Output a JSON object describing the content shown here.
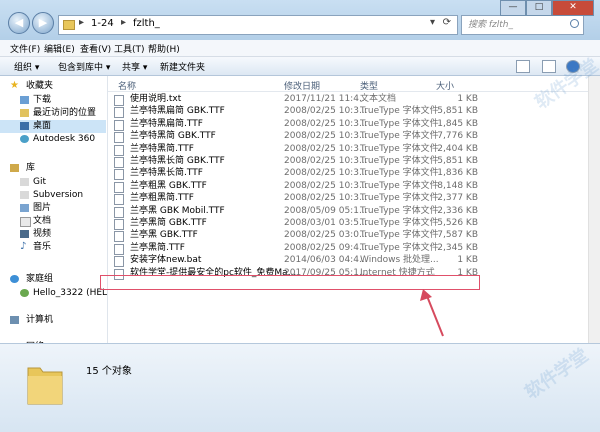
{
  "address": {
    "crumbs": [
      "1-24",
      "fzlth_"
    ]
  },
  "search": {
    "placeholder": "搜索 fzlth_"
  },
  "window_controls": [
    "—",
    "□",
    "✕"
  ],
  "menu": [
    "文件(F)",
    "编辑(E)",
    "查看(V)",
    "工具(T)",
    "帮助(H)"
  ],
  "toolbar": {
    "organize": "组织 ▾",
    "include_library": "包含到库中 ▾",
    "share": "共享 ▾",
    "new_folder": "新建文件夹"
  },
  "nav": {
    "favorites": "收藏夹",
    "downloads": "下载",
    "recent": "最近访问的位置",
    "desktop": "桌面",
    "autodesk": "Autodesk 360",
    "libraries": "库",
    "git": "Git",
    "subversion": "Subversion",
    "pictures": "图片",
    "documents": "文档",
    "videos": "视频",
    "music": "音乐",
    "homegroup": "家庭组",
    "hello": "Hello_3322 (HEL",
    "computer": "计算机",
    "network": "网络"
  },
  "columns": {
    "name": "名称",
    "date": "修改日期",
    "type": "类型",
    "size": "大小"
  },
  "files": [
    {
      "name": "使用说明.txt",
      "date": "2017/11/21 11:4...",
      "type": "文本文档",
      "size": "1 KB"
    },
    {
      "name": "兰亭特黑扁简 GBK.TTF",
      "date": "2008/02/25 10:3...",
      "type": "TrueType 字体文件",
      "size": "5,851 KB"
    },
    {
      "name": "兰亭特黑扁简.TTF",
      "date": "2008/02/25 10:3...",
      "type": "TrueType 字体文件",
      "size": "1,845 KB"
    },
    {
      "name": "兰亭特黑简 GBK.TTF",
      "date": "2008/02/25 10:3...",
      "type": "TrueType 字体文件",
      "size": "7,776 KB"
    },
    {
      "name": "兰亭特黑简.TTF",
      "date": "2008/02/25 10:3...",
      "type": "TrueType 字体文件",
      "size": "2,404 KB"
    },
    {
      "name": "兰亭特黑长简 GBK.TTF",
      "date": "2008/02/25 10:3...",
      "type": "TrueType 字体文件",
      "size": "5,851 KB"
    },
    {
      "name": "兰亭特黑长简.TTF",
      "date": "2008/02/25 10:3...",
      "type": "TrueType 字体文件",
      "size": "1,836 KB"
    },
    {
      "name": "兰亭粗黑 GBK.TTF",
      "date": "2008/02/25 10:3...",
      "type": "TrueType 字体文件",
      "size": "8,148 KB"
    },
    {
      "name": "兰亭粗黑简.TTF",
      "date": "2008/02/25 10:3...",
      "type": "TrueType 字体文件",
      "size": "2,377 KB"
    },
    {
      "name": "兰亭黑 GBK Mobil.TTF",
      "date": "2008/05/09 05:1...",
      "type": "TrueType 字体文件",
      "size": "2,336 KB"
    },
    {
      "name": "兰亭黑简 GBK.TTF",
      "date": "2008/03/01 03:5...",
      "type": "TrueType 字体文件",
      "size": "5,526 KB"
    },
    {
      "name": "兰亭黑 GBK.TTF",
      "date": "2008/02/25 03:0...",
      "type": "TrueType 字体文件",
      "size": "7,587 KB"
    },
    {
      "name": "兰亭黑简.TTF",
      "date": "2008/02/25 09:4...",
      "type": "TrueType 字体文件",
      "size": "2,345 KB"
    },
    {
      "name": "安装字体new.bat",
      "date": "2014/06/03 04:4...",
      "type": "Windows 批处理...",
      "size": "1 KB"
    },
    {
      "name": "软件学堂-提供最安全的pc软件_免费Ma...",
      "date": "2017/09/25 05:1...",
      "type": "Internet 快捷方式",
      "size": "1 KB"
    }
  ],
  "status": {
    "count": "15 个对象"
  },
  "colors": {
    "highlight": "#e0506a",
    "selected_nav": "#cce4f7"
  }
}
